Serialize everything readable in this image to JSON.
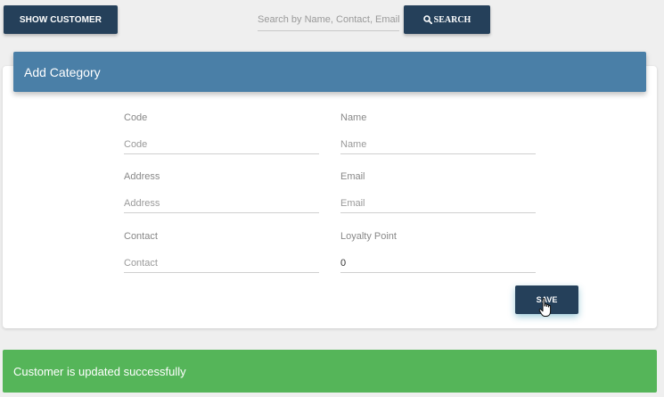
{
  "toolbar": {
    "show_customer_label": "SHOW CUSTOMER",
    "search_placeholder": "Search by Name, Contact, Email",
    "search_value": "",
    "search_label": "SEARCH",
    "search_icon": "search-icon"
  },
  "form": {
    "title": "Add Category",
    "fields": {
      "code": {
        "label": "Code",
        "placeholder": "Code",
        "value": ""
      },
      "name": {
        "label": "Name",
        "placeholder": "Name",
        "value": ""
      },
      "address": {
        "label": "Address",
        "placeholder": "Address",
        "value": ""
      },
      "email": {
        "label": "Email",
        "placeholder": "Email",
        "value": ""
      },
      "contact": {
        "label": "Contact",
        "placeholder": "Contact",
        "value": ""
      },
      "loyalty": {
        "label": "Loyalty Point",
        "placeholder": "",
        "value": "0"
      }
    },
    "save_label": "SAVE"
  },
  "alert": {
    "message": "Customer is updated successfully"
  },
  "colors": {
    "button_dark": "#25405a",
    "header_blue": "#4a7fa7",
    "success_green": "#55b559",
    "page_bg": "#efefef"
  }
}
